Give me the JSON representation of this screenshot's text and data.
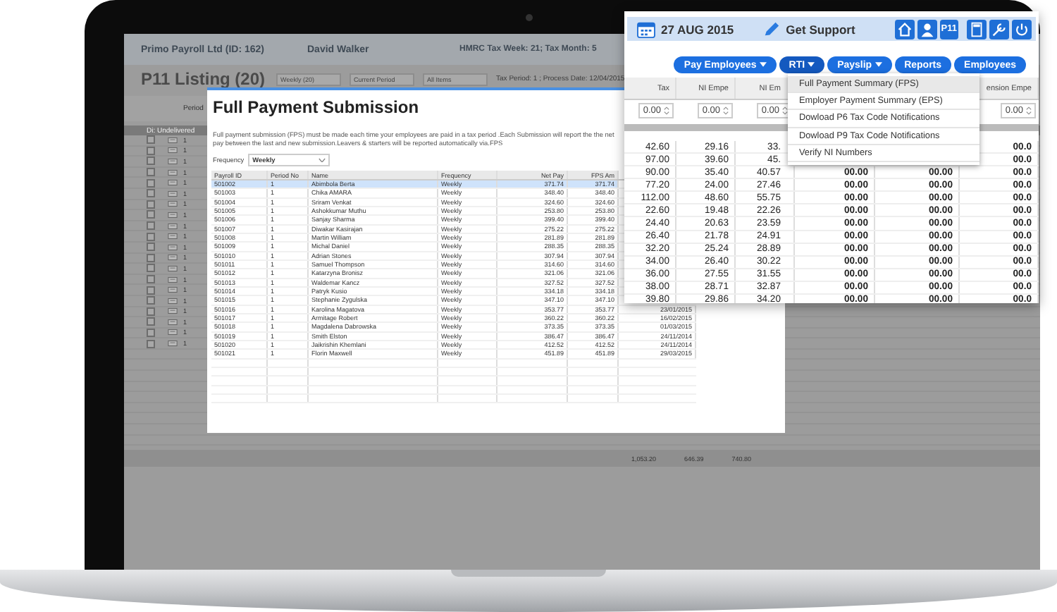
{
  "app": {
    "company": "Primo Payroll Ltd (ID: 162)",
    "user": "David Walker",
    "tax_info": "HMRC Tax Week: 21; Tax Month: 5",
    "title": "P11 Listing (20)",
    "filters": [
      "Weekly (20)",
      "Current Period",
      "All Items"
    ],
    "process_info": "Tax Period: 1 ; Process Date: 12/04/2015",
    "column_header": "Period",
    "group": "Di: Undelivered",
    "rows": [
      {
        "checked": false,
        "period": "1"
      },
      {
        "checked": false,
        "period": "1"
      },
      {
        "checked": false,
        "period": "1"
      },
      {
        "checked": false,
        "period": "1"
      },
      {
        "checked": false,
        "period": "1"
      },
      {
        "checked": false,
        "period": "1"
      },
      {
        "checked": false,
        "period": "1"
      },
      {
        "checked": false,
        "period": "1"
      },
      {
        "checked": false,
        "period": "1"
      },
      {
        "checked": false,
        "period": "1"
      },
      {
        "checked": false,
        "period": "1"
      },
      {
        "checked": false,
        "period": "1"
      },
      {
        "checked": false,
        "period": "1"
      },
      {
        "checked": false,
        "period": "1"
      },
      {
        "checked": false,
        "period": "1"
      },
      {
        "checked": false,
        "period": "1"
      },
      {
        "checked": false,
        "period": "1"
      },
      {
        "checked": false,
        "period": "1"
      },
      {
        "checked": false,
        "period": "1"
      },
      {
        "checked": false,
        "period": "1"
      }
    ],
    "totals": [
      "1,053.20",
      "646.39",
      "740.80"
    ]
  },
  "dialog": {
    "title": "Full Payment Submission",
    "description": "Full payment submission (FPS) must be made each time your employees are paid in a tax period .Each Submission will report the the net pay between the last and new submission.Leavers & starters will be reported automatically via.FPS",
    "frequency_label": "Frequency",
    "frequency": "Weekly",
    "columns": [
      "Payroll ID",
      "Period No",
      "Name",
      "Frequency",
      "Net Pay",
      "FPS Am"
    ],
    "rows": [
      {
        "payroll_id": "501002",
        "period_no": "1",
        "name": "Abimbola Berta",
        "frequency": "Weekly",
        "net_pay": "371.74",
        "fps_amount": "371.74",
        "selected": true
      },
      {
        "payroll_id": "501003",
        "period_no": "1",
        "name": "Chika AMARA",
        "frequency": "Weekly",
        "net_pay": "348.40",
        "fps_amount": "348.40",
        "selected": false
      },
      {
        "payroll_id": "501004",
        "period_no": "1",
        "name": "Sriram Venkat",
        "frequency": "Weekly",
        "net_pay": "324.60",
        "fps_amount": "324.60",
        "selected": false
      },
      {
        "payroll_id": "501005",
        "period_no": "1",
        "name": "Ashokkumar Muthu",
        "frequency": "Weekly",
        "net_pay": "253.80",
        "fps_amount": "253.80",
        "selected": false
      },
      {
        "payroll_id": "501006",
        "period_no": "1",
        "name": "Sanjay Sharma",
        "frequency": "Weekly",
        "net_pay": "399.40",
        "fps_amount": "399.40",
        "selected": false
      },
      {
        "payroll_id": "501007",
        "period_no": "1",
        "name": "Diwakar Kasirajan",
        "frequency": "Weekly",
        "net_pay": "275.22",
        "fps_amount": "275.22",
        "selected": false
      },
      {
        "payroll_id": "501008",
        "period_no": "1",
        "name": "Martin William",
        "frequency": "Weekly",
        "net_pay": "281.89",
        "fps_amount": "281.89",
        "selected": false
      },
      {
        "payroll_id": "501009",
        "period_no": "1",
        "name": "Michal Daniel",
        "frequency": "Weekly",
        "net_pay": "288.35",
        "fps_amount": "288.35",
        "selected": false
      },
      {
        "payroll_id": "501010",
        "period_no": "1",
        "name": "Adrian Stones",
        "frequency": "Weekly",
        "net_pay": "307.94",
        "fps_amount": "307.94",
        "selected": false
      },
      {
        "payroll_id": "501011",
        "period_no": "1",
        "name": "Samuel Thompson",
        "frequency": "Weekly",
        "net_pay": "314.60",
        "fps_amount": "314.60",
        "selected": false
      },
      {
        "payroll_id": "501012",
        "period_no": "1",
        "name": "Katarzyna Bronisz",
        "frequency": "Weekly",
        "net_pay": "321.06",
        "fps_amount": "321.06",
        "selected": false
      },
      {
        "payroll_id": "501013",
        "period_no": "1",
        "name": "Waldemar Kancz",
        "frequency": "Weekly",
        "net_pay": "327.52",
        "fps_amount": "327.52",
        "selected": false
      },
      {
        "payroll_id": "501014",
        "period_no": "1",
        "name": "Patryk Kusio",
        "frequency": "Weekly",
        "net_pay": "334.18",
        "fps_amount": "334.18",
        "selected": false
      },
      {
        "payroll_id": "501015",
        "period_no": "1",
        "name": "Stephanie Zygulska",
        "frequency": "Weekly",
        "net_pay": "347.10",
        "fps_amount": "347.10",
        "selected": false
      },
      {
        "payroll_id": "501016",
        "period_no": "1",
        "name": "Karolina Magatova",
        "frequency": "Weekly",
        "net_pay": "353.77",
        "fps_amount": "353.77",
        "date": "23/01/2015",
        "selected": false
      },
      {
        "payroll_id": "501017",
        "period_no": "1",
        "name": "Armitage Robert",
        "frequency": "Weekly",
        "net_pay": "360.22",
        "fps_amount": "360.22",
        "date": "16/02/2015",
        "selected": false
      },
      {
        "payroll_id": "501018",
        "period_no": "1",
        "name": "Magdalena Dabrowska",
        "frequency": "Weekly",
        "net_pay": "373.35",
        "fps_amount": "373.35",
        "date": "01/03/2015",
        "selected": false
      },
      {
        "payroll_id": "501019",
        "period_no": "1",
        "name": "Smith Elston",
        "frequency": "Weekly",
        "net_pay": "386.47",
        "fps_amount": "386.47",
        "date": "24/11/2014",
        "selected": false
      },
      {
        "payroll_id": "501020",
        "period_no": "1",
        "name": "Jaikrishin Khemlani",
        "frequency": "Weekly",
        "net_pay": "412.52",
        "fps_amount": "412.52",
        "date": "24/11/2014",
        "selected": false
      },
      {
        "payroll_id": "501021",
        "period_no": "1",
        "name": "Florin Maxwell",
        "frequency": "Weekly",
        "net_pay": "451.89",
        "fps_amount": "451.89",
        "date": "29/03/2015",
        "selected": false
      }
    ]
  },
  "panel": {
    "date": "27 AUG 2015",
    "support": "Get Support",
    "p11_label": "P11",
    "nav": [
      {
        "label": "Pay Employees",
        "dropdown": true,
        "expanded": false
      },
      {
        "label": "RTI",
        "dropdown": true,
        "expanded": true
      },
      {
        "label": "Payslip",
        "dropdown": true,
        "expanded": false
      },
      {
        "label": "Reports",
        "dropdown": false,
        "expanded": false
      },
      {
        "label": "Employees",
        "dropdown": false,
        "expanded": false
      }
    ],
    "menu": [
      {
        "label": "Full Payment Summary (FPS)",
        "selected": true
      },
      {
        "label": "Employer Payment Summary (EPS)",
        "selected": false
      },
      {
        "label": "Dowload P6 Tax Code Notifications",
        "selected": false
      },
      {
        "label": "Dowload P9 Tax Code Notifications",
        "selected": false
      },
      {
        "label": "Verify NI Numbers",
        "selected": false
      }
    ],
    "columns": {
      "tax": {
        "label": "Tax",
        "filter": "0.00"
      },
      "ni_employee": {
        "label": "NI Empe",
        "filter": "0.00"
      },
      "ni_employer": {
        "label": "NI Em",
        "filter": "0.00"
      },
      "pension_employee": {
        "label": "ension Empe",
        "filter": "0.00"
      }
    },
    "rows": [
      {
        "tax": "42.60",
        "ni_employee": "29.16",
        "ni_employer": "33.",
        "pension_employee": "00.0"
      },
      {
        "tax": "97.00",
        "ni_employee": "39.60",
        "ni_employer": "45.",
        "pension_employee": "00.0"
      },
      {
        "tax": "90.00",
        "ni_employee": "35.40",
        "ni_employer": "40.57",
        "column_4": "00.00",
        "column_5": "00.00",
        "pension_employee": "00.0"
      },
      {
        "tax": "77.20",
        "ni_employee": "24.00",
        "ni_employer": "27.46",
        "column_4": "00.00",
        "column_5": "00.00",
        "pension_employee": "00.0"
      },
      {
        "tax": "112.00",
        "ni_employee": "48.60",
        "ni_employer": "55.75",
        "column_4": "00.00",
        "column_5": "00.00",
        "pension_employee": "00.0"
      },
      {
        "tax": "22.60",
        "ni_employee": "19.48",
        "ni_employer": "22.26",
        "column_4": "00.00",
        "column_5": "00.00",
        "pension_employee": "00.0"
      },
      {
        "tax": "24.40",
        "ni_employee": "20.63",
        "ni_employer": "23.59",
        "column_4": "00.00",
        "column_5": "00.00",
        "pension_employee": "00.0"
      },
      {
        "tax": "26.40",
        "ni_employee": "21.78",
        "ni_employer": "24.91",
        "column_4": "00.00",
        "column_5": "00.00",
        "pension_employee": "00.0"
      },
      {
        "tax": "32.20",
        "ni_employee": "25.24",
        "ni_employer": "28.89",
        "column_4": "00.00",
        "column_5": "00.00",
        "pension_employee": "00.0"
      },
      {
        "tax": "34.00",
        "ni_employee": "26.40",
        "ni_employer": "30.22",
        "column_4": "00.00",
        "column_5": "00.00",
        "pension_employee": "00.0"
      },
      {
        "tax": "36.00",
        "ni_employee": "27.55",
        "ni_employer": "31.55",
        "column_4": "00.00",
        "column_5": "00.00",
        "pension_employee": "00.0"
      },
      {
        "tax": "38.00",
        "ni_employee": "28.71",
        "ni_employer": "32.87",
        "column_4": "00.00",
        "column_5": "00.00",
        "pension_employee": "00.0"
      },
      {
        "tax": "39.80",
        "ni_employee": "29.86",
        "ni_employer": "34.20",
        "column_4": "00.00",
        "column_5": "00.00",
        "pension_employee": "00.0"
      }
    ]
  }
}
